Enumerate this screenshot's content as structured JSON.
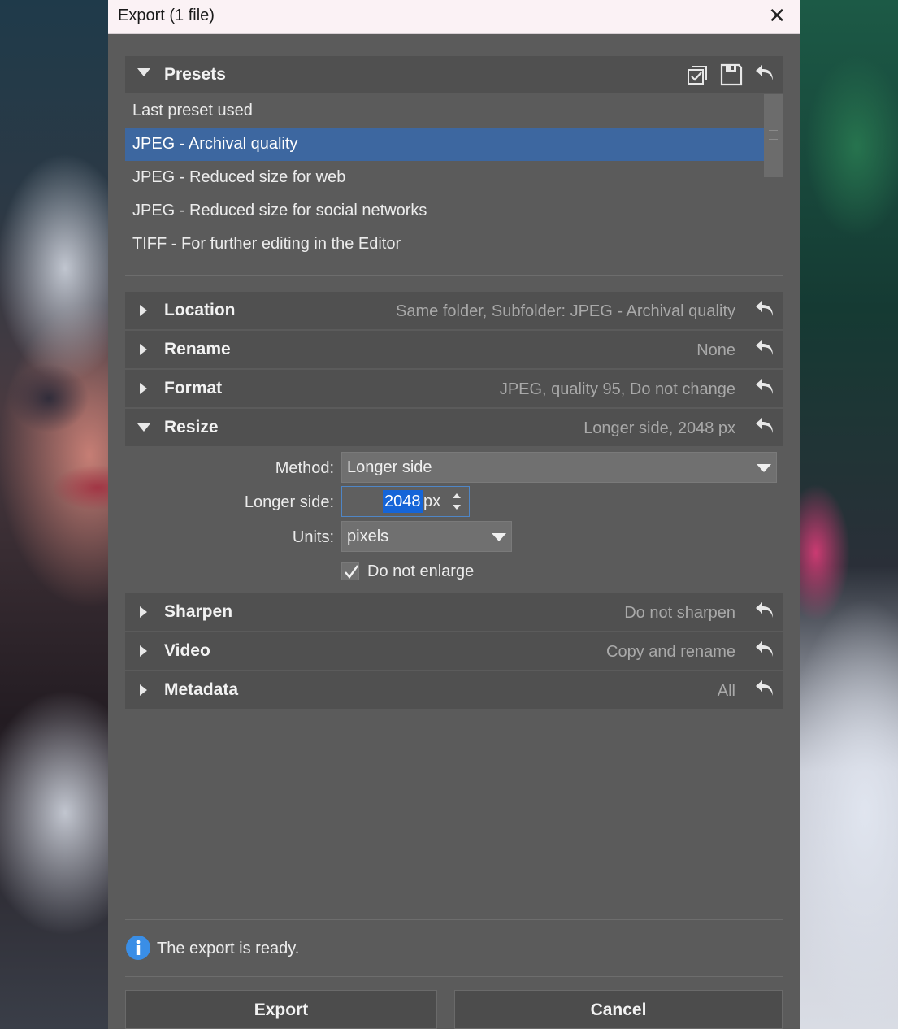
{
  "window": {
    "title": "Export (1 file)",
    "close_glyph": "✕"
  },
  "presets": {
    "title": "Presets",
    "toolbar_icons": [
      "manage-presets-icon",
      "save-preset-icon",
      "reset-icon"
    ],
    "items": [
      {
        "label": "Last preset used"
      },
      {
        "label": "JPEG - Archival quality",
        "selected": true
      },
      {
        "label": "JPEG - Reduced size for web"
      },
      {
        "label": "JPEG - Reduced size for social networks"
      },
      {
        "label": "TIFF - For further editing in the Editor"
      }
    ]
  },
  "sections": {
    "location": {
      "label": "Location",
      "summary": "Same folder, Subfolder: JPEG - Archival quality",
      "expanded": false
    },
    "rename": {
      "label": "Rename",
      "summary": "None",
      "expanded": false
    },
    "format": {
      "label": "Format",
      "summary": "JPEG, quality 95, Do not change",
      "expanded": false
    },
    "resize": {
      "label": "Resize",
      "summary": "Longer side, 2048 px",
      "expanded": true
    },
    "sharpen": {
      "label": "Sharpen",
      "summary": "Do not sharpen",
      "expanded": false
    },
    "video": {
      "label": "Video",
      "summary": "Copy and rename",
      "expanded": false
    },
    "metadata": {
      "label": "Metadata",
      "summary": "All",
      "expanded": false
    }
  },
  "resize": {
    "method_label": "Method:",
    "method_value": "Longer side",
    "longer_side_label": "Longer side:",
    "longer_side_value": "2048",
    "longer_side_unit": "px",
    "units_label": "Units:",
    "units_value": "pixels",
    "do_not_enlarge_label": "Do not enlarge",
    "do_not_enlarge_checked": true
  },
  "status": {
    "text": "The export is ready."
  },
  "buttons": {
    "export": "Export",
    "cancel": "Cancel"
  },
  "colors": {
    "selection": "#3d67a0",
    "input_highlight": "#1565d8",
    "info": "#3a8ee6"
  }
}
